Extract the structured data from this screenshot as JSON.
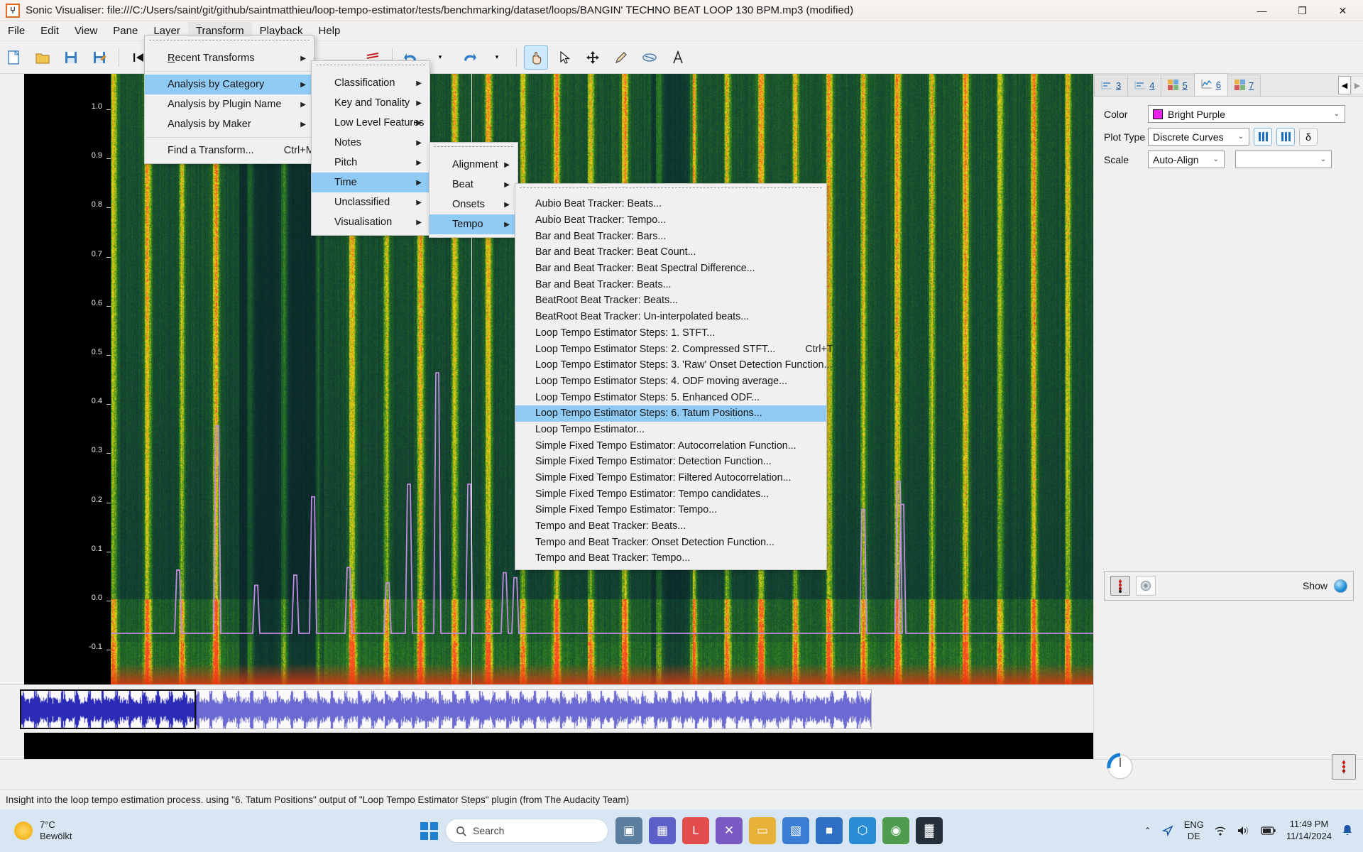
{
  "titlebar": {
    "app_icon": "waveform-icon",
    "title": "Sonic Visualiser: file:///C:/Users/saint/git/github/saintmatthieu/loop-tempo-estimator/tests/benchmarking/dataset/loops/BANGIN' TECHNO BEAT LOOP 130 BPM.mp3 (modified)",
    "minimize": "—",
    "maximize": "❐",
    "close": "✕"
  },
  "menubar": {
    "items": [
      {
        "label": "File",
        "active": false
      },
      {
        "label": "Edit",
        "active": false
      },
      {
        "label": "View",
        "active": false
      },
      {
        "label": "Pane",
        "active": false
      },
      {
        "label": "Layer",
        "active": false
      },
      {
        "label": "Transform",
        "active": true
      },
      {
        "label": "Playback",
        "active": false
      },
      {
        "label": "Help",
        "active": false
      }
    ]
  },
  "toolbar": {
    "buttons": [
      {
        "name": "new-session",
        "glyph": "□"
      },
      {
        "name": "open-session",
        "glyph": "▱"
      },
      {
        "name": "save-session",
        "glyph": "▤"
      },
      {
        "name": "save-session-as",
        "glyph": "▥"
      },
      {
        "name": "rewind-to-start",
        "glyph": "⏮"
      },
      {
        "name": "rewind",
        "glyph": "⏪"
      },
      {
        "name": "play",
        "glyph": "▶"
      },
      {
        "name": "fast-forward",
        "glyph": "⏩"
      },
      {
        "name": "forward-to-end",
        "glyph": "⏭"
      },
      {
        "name": "record",
        "glyph": "●"
      },
      {
        "name": "loop-toggle",
        "glyph": "↺"
      },
      {
        "name": "solo-toggle",
        "glyph": "♪"
      },
      {
        "name": "align-toggle",
        "glyph": "≣"
      },
      {
        "name": "undo",
        "glyph": "↶"
      },
      {
        "name": "redo",
        "glyph": "↷"
      },
      {
        "name": "navigate-tool",
        "glyph": "✋"
      },
      {
        "name": "select-tool",
        "glyph": "↖"
      },
      {
        "name": "edit-tool",
        "glyph": "✥"
      },
      {
        "name": "draw-tool",
        "glyph": "✎"
      },
      {
        "name": "erase-tool",
        "glyph": "⬭"
      },
      {
        "name": "measure-tool",
        "glyph": "⑁"
      }
    ]
  },
  "transform_menu": {
    "items": [
      {
        "label": "Recent Transforms",
        "submenu": true,
        "accel": "R",
        "highlight": false
      },
      {
        "label": "Analysis by Category",
        "submenu": true,
        "highlight": true
      },
      {
        "label": "Analysis by Plugin Name",
        "submenu": true,
        "highlight": false
      },
      {
        "label": "Analysis by Maker",
        "submenu": true,
        "highlight": false
      },
      {
        "label": "Find a Transform...",
        "submenu": false,
        "shortcut": "Ctrl+M",
        "highlight": false
      }
    ]
  },
  "category_menu": {
    "items": [
      {
        "label": "Classification",
        "submenu": true,
        "highlight": false
      },
      {
        "label": "Key and Tonality",
        "submenu": true,
        "highlight": false
      },
      {
        "label": "Low Level Features",
        "submenu": true,
        "highlight": false
      },
      {
        "label": "Notes",
        "submenu": true,
        "highlight": false
      },
      {
        "label": "Pitch",
        "submenu": true,
        "highlight": false
      },
      {
        "label": "Time",
        "submenu": true,
        "highlight": true
      },
      {
        "label": "Unclassified",
        "submenu": true,
        "highlight": false
      },
      {
        "label": "Visualisation",
        "submenu": true,
        "highlight": false
      }
    ]
  },
  "time_menu": {
    "items": [
      {
        "label": "Alignment",
        "submenu": true,
        "highlight": false
      },
      {
        "label": "Beat",
        "submenu": true,
        "highlight": false
      },
      {
        "label": "Onsets",
        "submenu": true,
        "highlight": false
      },
      {
        "label": "Tempo",
        "submenu": true,
        "highlight": true
      }
    ]
  },
  "tempo_menu": {
    "items": [
      {
        "label": "Aubio Beat Tracker: Beats...",
        "highlight": false,
        "shortcut": ""
      },
      {
        "label": "Aubio Beat Tracker: Tempo...",
        "highlight": false,
        "shortcut": ""
      },
      {
        "label": "Bar and Beat Tracker: Bars...",
        "highlight": false,
        "shortcut": ""
      },
      {
        "label": "Bar and Beat Tracker: Beat Count...",
        "highlight": false,
        "shortcut": ""
      },
      {
        "label": "Bar and Beat Tracker: Beat Spectral Difference...",
        "highlight": false,
        "shortcut": ""
      },
      {
        "label": "Bar and Beat Tracker: Beats...",
        "highlight": false,
        "shortcut": ""
      },
      {
        "label": "BeatRoot Beat Tracker: Beats...",
        "highlight": false,
        "shortcut": ""
      },
      {
        "label": "BeatRoot Beat Tracker: Un-interpolated beats...",
        "highlight": false,
        "shortcut": ""
      },
      {
        "label": "Loop Tempo Estimator Steps: 1. STFT...",
        "highlight": false,
        "shortcut": ""
      },
      {
        "label": "Loop Tempo Estimator Steps: 2. Compressed STFT...",
        "highlight": false,
        "shortcut": "Ctrl+T"
      },
      {
        "label": "Loop Tempo Estimator Steps: 3. 'Raw' Onset Detection Function...",
        "highlight": false,
        "shortcut": ""
      },
      {
        "label": "Loop Tempo Estimator Steps: 4. ODF moving average...",
        "highlight": false,
        "shortcut": ""
      },
      {
        "label": "Loop Tempo Estimator Steps: 5. Enhanced ODF...",
        "highlight": false,
        "shortcut": ""
      },
      {
        "label": "Loop Tempo Estimator Steps: 6. Tatum Positions...",
        "highlight": true,
        "shortcut": ""
      },
      {
        "label": "Loop Tempo Estimator...",
        "highlight": false,
        "shortcut": ""
      },
      {
        "label": "Simple Fixed Tempo Estimator: Autocorrelation Function...",
        "highlight": false,
        "shortcut": ""
      },
      {
        "label": "Simple Fixed Tempo Estimator: Detection Function...",
        "highlight": false,
        "shortcut": ""
      },
      {
        "label": "Simple Fixed Tempo Estimator: Filtered Autocorrelation...",
        "highlight": false,
        "shortcut": ""
      },
      {
        "label": "Simple Fixed Tempo Estimator: Tempo candidates...",
        "highlight": false,
        "shortcut": ""
      },
      {
        "label": "Simple Fixed Tempo Estimator: Tempo...",
        "highlight": false,
        "shortcut": ""
      },
      {
        "label": "Tempo and Beat Tracker: Beats...",
        "highlight": false,
        "shortcut": ""
      },
      {
        "label": "Tempo and Beat Tracker: Onset Detection Function...",
        "highlight": false,
        "shortcut": ""
      },
      {
        "label": "Tempo and Beat Tracker: Tempo...",
        "highlight": false,
        "shortcut": ""
      }
    ]
  },
  "pane": {
    "vertical_axis_labels": [
      "1.0",
      "0.9",
      "0.8",
      "0.7",
      "0.6",
      "0.5",
      "0.4",
      "0.3",
      "0.2",
      "0.1",
      "0.0",
      "-0.1"
    ],
    "curve_color": "#c08ae0"
  },
  "right_panel": {
    "tabs": [
      {
        "label": "3",
        "icon": "timeline-icon",
        "active": false
      },
      {
        "label": "4",
        "icon": "timeline-icon",
        "active": false
      },
      {
        "label": "5",
        "icon": "grid-icon",
        "active": false
      },
      {
        "label": "6",
        "icon": "curve-icon",
        "active": true
      },
      {
        "label": "7",
        "icon": "grid-icon",
        "active": false
      }
    ],
    "prev_tab_arrow": "◀",
    "next_tab_arrow": "▶",
    "rows": {
      "color_label": "Color",
      "color_value": "Bright Purple",
      "color_hex": "#ee22ee",
      "plot_type_label": "Plot Type",
      "plot_type_value": "Discrete Curves",
      "delta_label": "δ",
      "scale_label": "Scale",
      "scale_value": "Auto-Align",
      "unit_value": ""
    },
    "show_label": "Show"
  },
  "statusbar": {
    "text": "Insight into the loop tempo estimation process. using \"6. Tatum Positions\" output of \"Loop Tempo Estimator Steps\" plugin (from The Audacity Team)"
  },
  "taskbar": {
    "weather_temp": "7°C",
    "weather_desc": "Bewölkt",
    "search_placeholder": "Search",
    "search_icon": "search-icon",
    "apps": [
      {
        "name": "task-view",
        "glyph": "▣",
        "color": "#5a7f9e"
      },
      {
        "name": "teams",
        "glyph": "▦",
        "color": "#5b5fc7"
      },
      {
        "name": "loop-app",
        "glyph": "L",
        "color": "#e24c4c"
      },
      {
        "name": "vs-code-insiders",
        "glyph": "✕",
        "color": "#7a5bc4"
      },
      {
        "name": "file-explorer",
        "glyph": "▭",
        "color": "#e8b23a"
      },
      {
        "name": "store",
        "glyph": "▧",
        "color": "#3b7fd4"
      },
      {
        "name": "blue-app",
        "glyph": "■",
        "color": "#2f6fc4"
      },
      {
        "name": "vs-code",
        "glyph": "⬡",
        "color": "#2b8cd6"
      },
      {
        "name": "chrome",
        "glyph": "◉",
        "color": "#4f9c4f"
      },
      {
        "name": "sonic-visualiser",
        "glyph": "▓",
        "color": "#25303b"
      }
    ],
    "tray": {
      "chevron": "⌃",
      "location_icon": "location-arrow-icon",
      "lang_primary": "ENG",
      "lang_secondary": "DE",
      "wifi_icon": "wifi-icon",
      "volume_icon": "speaker-icon",
      "battery_icon": "battery-icon",
      "time": "11:49 PM",
      "date": "11/14/2024",
      "notification_icon": "bell-icon"
    }
  }
}
